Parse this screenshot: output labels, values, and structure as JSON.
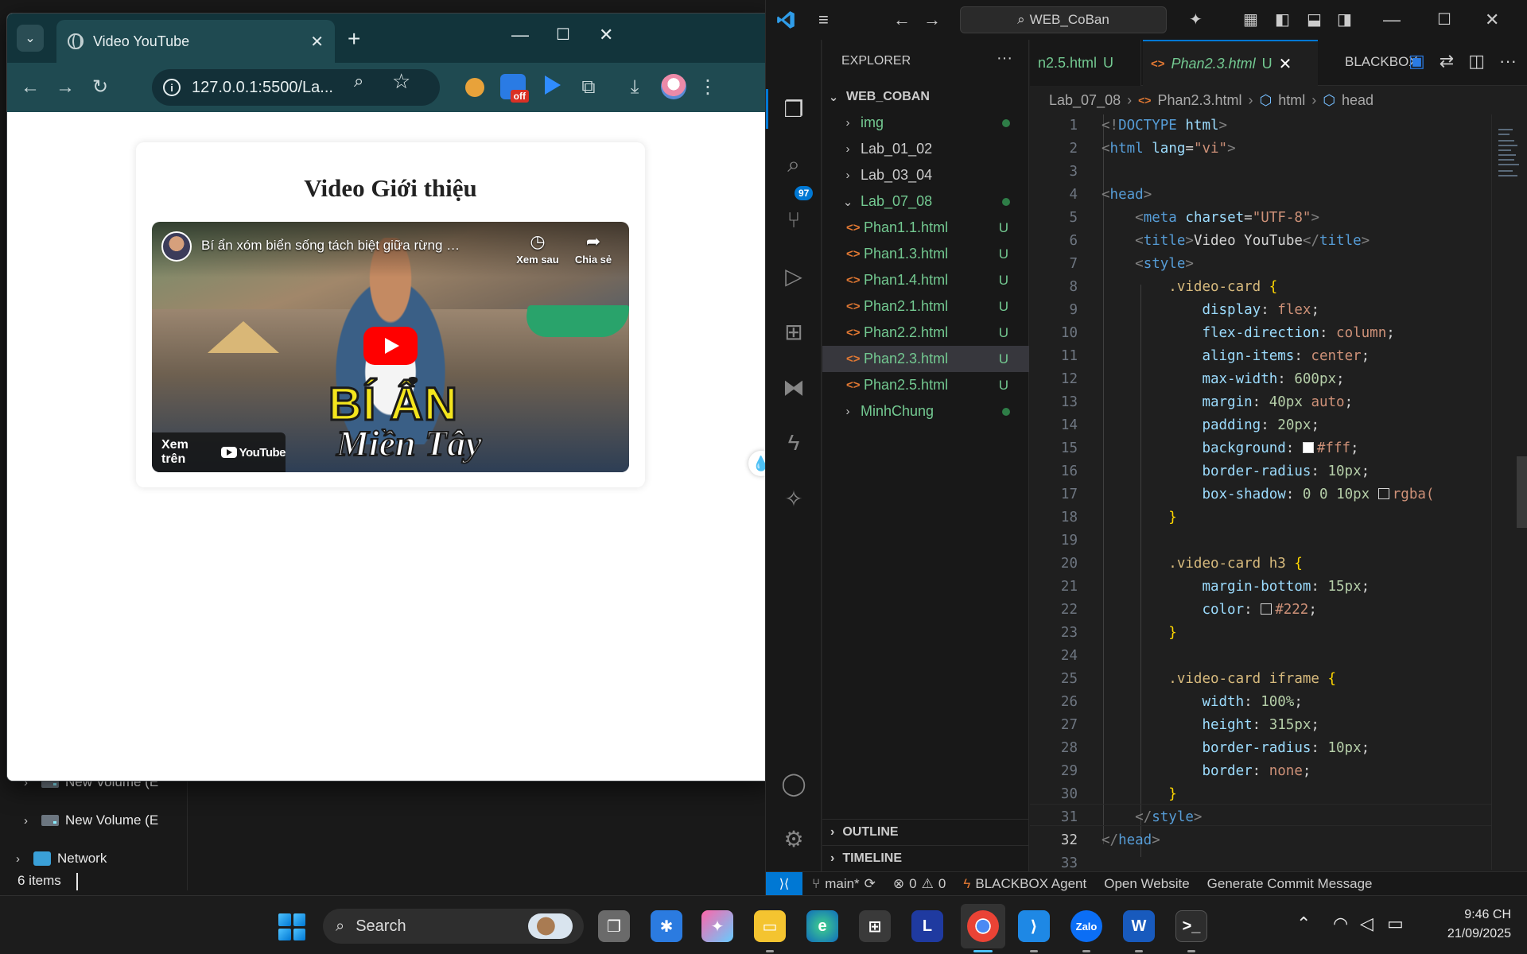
{
  "background_explorer": {
    "items": [
      {
        "label": "New Volume (E"
      },
      {
        "label": "New Volume (E"
      },
      {
        "label": "Network"
      }
    ],
    "status": "6 items"
  },
  "chrome": {
    "tab_title": "Video YouTube",
    "address": "127.0.0.1:5500/La...",
    "page": {
      "heading": "Video Giới thiệu",
      "video": {
        "title": "Bí ẩn xóm biển sống tách biệt giữa rừng - Miền...",
        "watch_later": "Xem sau",
        "share": "Chia sẻ",
        "watch_on": "Xem trên",
        "youtube_logo": "YouTube",
        "thumb_line1": "BÍ ẨN",
        "thumb_line2": "Miền Tây"
      }
    },
    "extension_badge": "off"
  },
  "vscode": {
    "search": "WEB_CoBan",
    "explorer_label": "EXPLORER",
    "root": "WEB_COBAN",
    "tree": [
      {
        "label": "img",
        "type": "folder",
        "status": "dot"
      },
      {
        "label": "Lab_01_02",
        "type": "folder",
        "status": ""
      },
      {
        "label": "Lab_03_04",
        "type": "folder",
        "status": ""
      },
      {
        "label": "Lab_07_08",
        "type": "folder-open",
        "status": "dot"
      },
      {
        "label": "Phan1.1.html",
        "type": "file",
        "status": "U"
      },
      {
        "label": "Phan1.3.html",
        "type": "file",
        "status": "U"
      },
      {
        "label": "Phan1.4.html",
        "type": "file",
        "status": "U"
      },
      {
        "label": "Phan2.1.html",
        "type": "file",
        "status": "U"
      },
      {
        "label": "Phan2.2.html",
        "type": "file",
        "status": "U"
      },
      {
        "label": "Phan2.3.html",
        "type": "file",
        "status": "U"
      },
      {
        "label": "Phan2.5.html",
        "type": "file",
        "status": "U"
      },
      {
        "label": "MinhChung",
        "type": "folder",
        "status": "dot"
      }
    ],
    "outline": "OUTLINE",
    "timeline": "TIMELINE",
    "source_control_badge": "97",
    "tabs": {
      "inactive": "n2.5.html",
      "inactive_status": "U",
      "active": "Phan2.3.html",
      "active_status": "U",
      "extension": "BLACKBOX"
    },
    "breadcrumbs": [
      "Lab_07_08",
      "Phan2.3.html",
      "html",
      "head"
    ],
    "current_line": "32",
    "statusbar": {
      "branch": "main*",
      "errors": "0",
      "warnings": "0",
      "agent": "BLACKBOX Agent",
      "open_website": "Open Website",
      "commit": "Generate Commit Message"
    }
  },
  "taskbar": {
    "search": "Search",
    "time": "9:46 CH",
    "date": "21/09/2025"
  }
}
